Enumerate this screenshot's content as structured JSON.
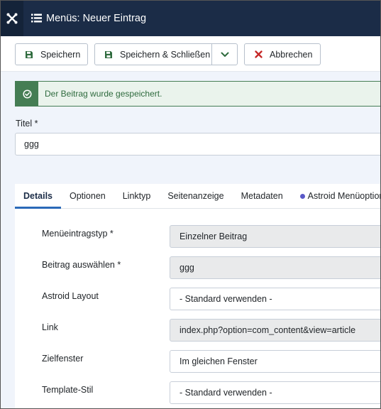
{
  "header": {
    "title": "Menüs: Neuer Eintrag",
    "logo_icon": "joomla-logo-icon",
    "title_icon": "list-icon",
    "bg_color": "#1b2c47"
  },
  "toolbar": {
    "save_label": "Speichern",
    "save_close_label": "Speichern & Schließen",
    "cancel_label": "Abbrechen",
    "save_icon": "floppy-disk-icon",
    "cancel_icon": "x-icon",
    "accent_green": "#2f6b3e",
    "accent_red": "#c52827"
  },
  "alert": {
    "message": "Der Beitrag wurde gespeichert.",
    "icon": "check-circle-icon",
    "color": "#457d54"
  },
  "title_field": {
    "label": "Titel *",
    "value": "ggg"
  },
  "tabs": [
    {
      "label": "Details",
      "active": true
    },
    {
      "label": "Optionen",
      "active": false
    },
    {
      "label": "Linktyp",
      "active": false
    },
    {
      "label": "Seitenanzeige",
      "active": false
    },
    {
      "label": "Metadaten",
      "active": false
    },
    {
      "label": "Astroid Menüoptionen",
      "active": false
    }
  ],
  "form": {
    "menu_item_type": {
      "label": "Menüeintragstyp *",
      "value": "Einzelner Beitrag"
    },
    "select_article": {
      "label": "Beitrag auswählen *",
      "value": "ggg"
    },
    "astroid_layout": {
      "label": "Astroid Layout",
      "value": "- Standard verwenden -"
    },
    "link": {
      "label": "Link",
      "value": "index.php?option=com_content&view=article"
    },
    "target_window": {
      "label": "Zielfenster",
      "value": "Im gleichen Fenster"
    },
    "template_style": {
      "label": "Template-Stil",
      "value": "- Standard verwenden -"
    }
  }
}
